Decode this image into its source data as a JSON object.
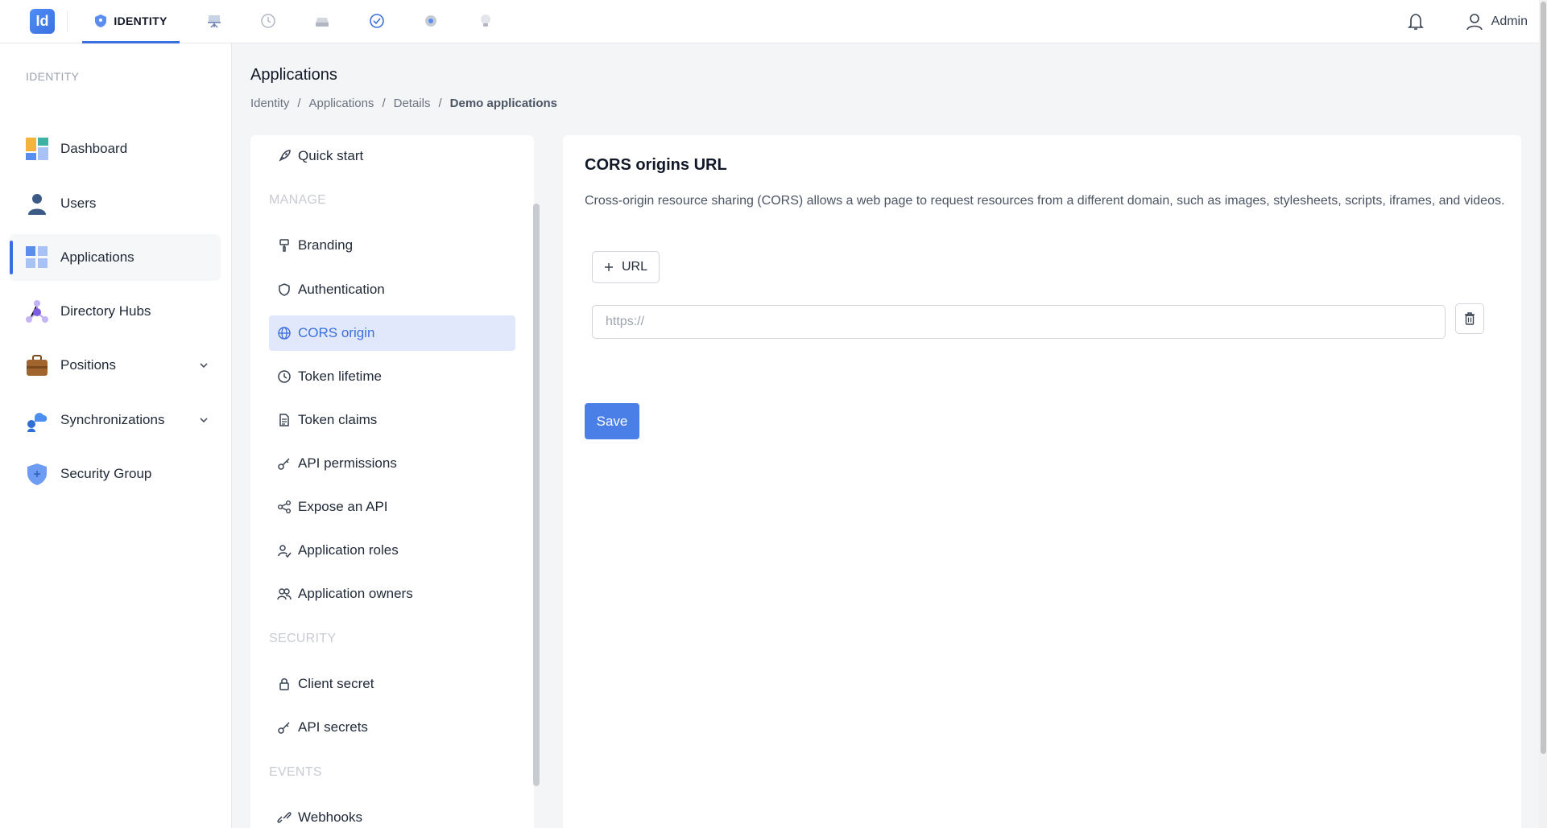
{
  "app": {
    "logo_text": "Id",
    "active_tab": "IDENTITY",
    "user": "Admin",
    "accent": "#3b6fe0"
  },
  "top_icons": [
    "identity-icon",
    "presentation-icon",
    "history-icon",
    "storage-icon",
    "check-circle-icon",
    "settings-icon",
    "lightbulb-icon"
  ],
  "sidebar": {
    "section": "IDENTITY",
    "items": [
      {
        "label": "Dashboard",
        "icon": "dashboard-icon"
      },
      {
        "label": "Users",
        "icon": "user-icon"
      },
      {
        "label": "Applications",
        "icon": "applications-icon",
        "active": true
      },
      {
        "label": "Directory Hubs",
        "icon": "hub-icon"
      },
      {
        "label": "Positions",
        "icon": "briefcase-icon",
        "expandable": true
      },
      {
        "label": "Synchronizations",
        "icon": "sync-icon",
        "expandable": true
      },
      {
        "label": "Security Group",
        "icon": "shield-icon"
      }
    ]
  },
  "header": {
    "title": "Applications",
    "breadcrumb": [
      "Identity",
      "Applications",
      "Details",
      "Demo applications"
    ]
  },
  "settings_menu": {
    "quick_start": "Quick start",
    "manage_section": "MANAGE",
    "manage_items": [
      "Branding",
      "Authentication",
      "CORS origin",
      "Token lifetime",
      "Token claims",
      "API permissions",
      "Expose an API",
      "Application roles",
      "Application owners"
    ],
    "security_section": "SECURITY",
    "security_items": [
      "Client secret",
      "API secrets"
    ],
    "events_section": "EVENTS",
    "events_items": [
      "Webhooks"
    ],
    "active": "CORS origin"
  },
  "content": {
    "title": "CORS origins URL",
    "description": "Cross-origin resource sharing (CORS) allows a web page to request resources from a different domain, such as images, stylesheets, scripts, iframes, and videos.",
    "add_url_label": "URL",
    "url_placeholder": "https://",
    "url_value": "",
    "save_label": "Save"
  }
}
